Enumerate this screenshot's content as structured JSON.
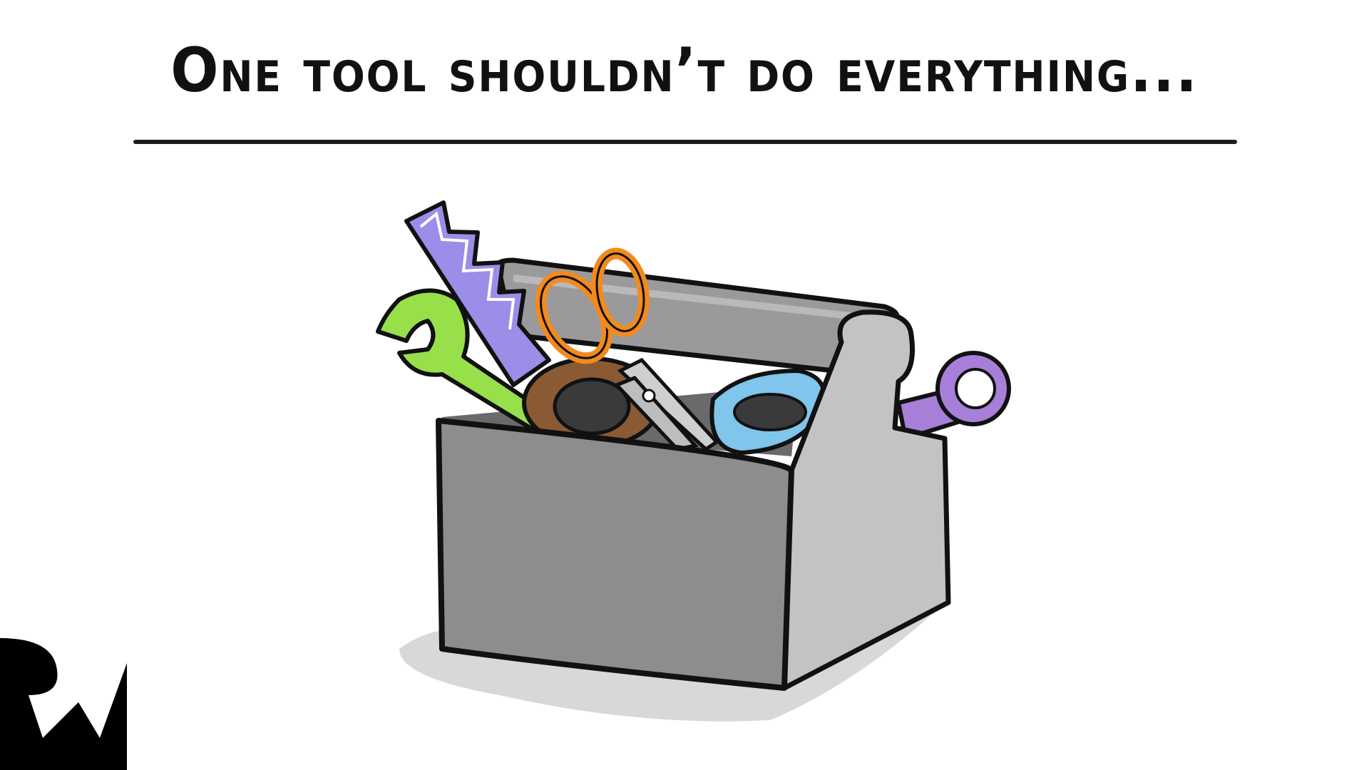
{
  "slide": {
    "title": "One tool shouldn’t do everything..."
  },
  "colors": {
    "ink": "#111111",
    "box_front": "#8d8d8f",
    "box_side": "#c3c3c5",
    "box_handle": "#9a9a9c",
    "shadow": "#d8d8d8",
    "saw_blade": "#9b8ee8",
    "wrench": "#98e04a",
    "scissors_handle": "#f28a1e",
    "tape": "#8a5a35",
    "blue_tool": "#7fc5ec",
    "purple_wrench": "#a77fd8"
  },
  "icons": {
    "illustration": "toolbox-icon",
    "logo": "rw-logo-icon"
  }
}
